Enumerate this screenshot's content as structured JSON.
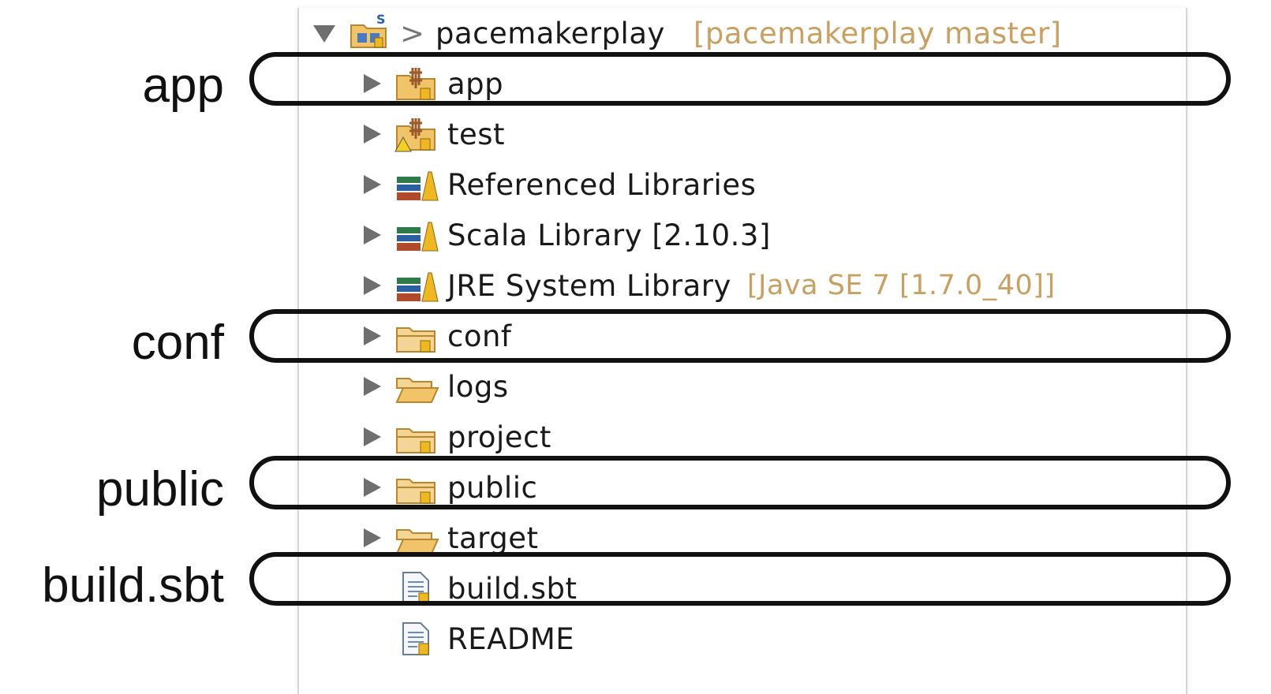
{
  "project": {
    "name": "pacemakerplay",
    "decoration": "[pacemakerplay master]",
    "prefix": ">"
  },
  "tree": [
    {
      "label": "app",
      "icon": "package-folder-icon",
      "expandable": true
    },
    {
      "label": "test",
      "icon": "package-folder-warning-icon",
      "expandable": true
    },
    {
      "label": "Referenced Libraries",
      "icon": "library-icon",
      "expandable": true
    },
    {
      "label": "Scala Library [2.10.3]",
      "icon": "library-icon",
      "expandable": true
    },
    {
      "label": "JRE System Library",
      "decoration": "[Java SE 7 [1.7.0_40]]",
      "icon": "library-icon",
      "expandable": true
    },
    {
      "label": "conf",
      "icon": "folder-icon",
      "expandable": true
    },
    {
      "label": "logs",
      "icon": "folder-open-icon",
      "expandable": true
    },
    {
      "label": "project",
      "icon": "folder-icon",
      "expandable": true
    },
    {
      "label": "public",
      "icon": "folder-icon",
      "expandable": true
    },
    {
      "label": "target",
      "icon": "folder-open-icon",
      "expandable": true
    },
    {
      "label": "build.sbt",
      "icon": "file-icon",
      "expandable": false
    },
    {
      "label": "README",
      "icon": "file-icon",
      "expandable": false
    }
  ],
  "callouts": [
    {
      "label": "app"
    },
    {
      "label": "conf"
    },
    {
      "label": "public"
    },
    {
      "label": "build.sbt"
    }
  ],
  "colors": {
    "folder": "#f2c46a",
    "folder_dark": "#b9862c",
    "callout_border": "#111111"
  }
}
